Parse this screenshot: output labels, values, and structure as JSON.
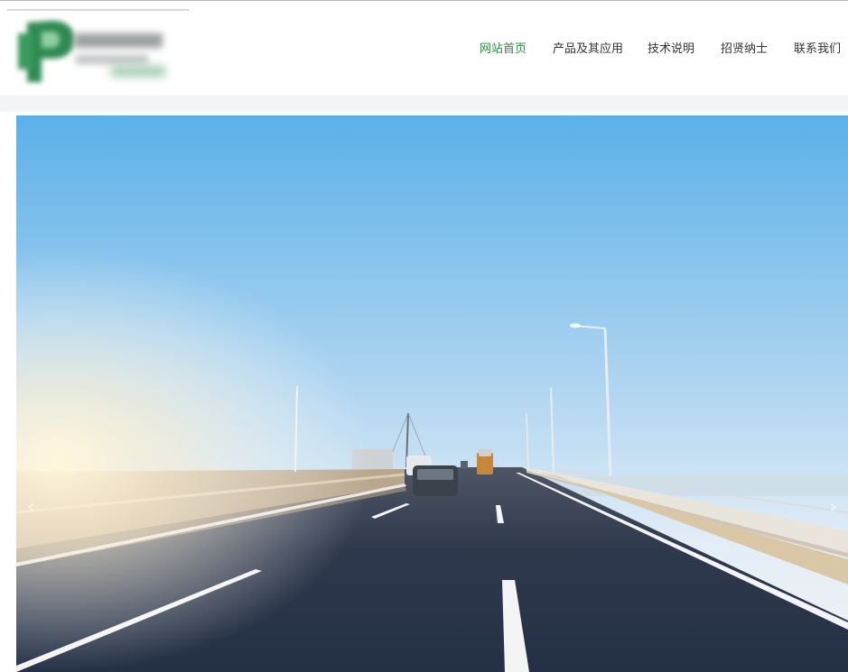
{
  "header": {
    "logo_icon": "company-logo",
    "nav": [
      {
        "label": "网站首页",
        "active": true
      },
      {
        "label": "产品及其应用",
        "active": false
      },
      {
        "label": "技术说明",
        "active": false
      },
      {
        "label": "招贤纳士",
        "active": false
      },
      {
        "label": "联系我们",
        "active": false
      }
    ]
  },
  "banner": {
    "prev_icon": "chevron-left-icon",
    "next_icon": "chevron-right-icon",
    "prev_glyph": "‹",
    "next_glyph": "›"
  },
  "colors": {
    "nav_active": "#2e8b3e",
    "nav_text": "#333333",
    "sky_top": "#5bb0e8",
    "road": "#2a3448"
  }
}
